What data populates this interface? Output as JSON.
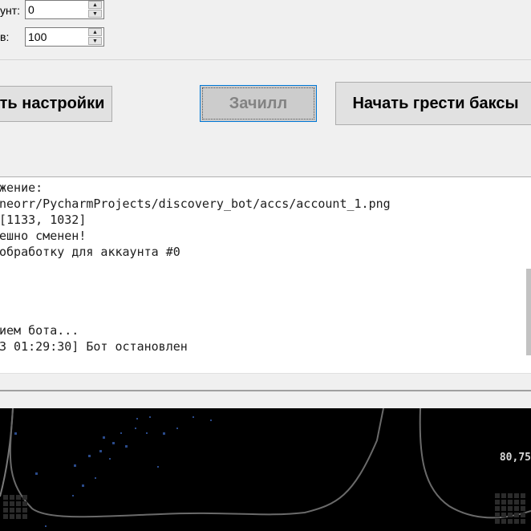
{
  "settings": {
    "account_label": "унт:",
    "account_value": "0",
    "count_label": "в:",
    "count_value": "100"
  },
  "buttons": {
    "save_settings": "ть настройки",
    "chill": "Зачилл",
    "start": "Начать грести баксы"
  },
  "log": {
    "lines": [
      "жение:",
      "neorr/PycharmProjects/discovery_bot/accs/account_1.png",
      "[1133, 1032]",
      "ешно сменен!",
      "обработку для аккаунта #0",
      "",
      "",
      "",
      "ием бота...",
      "3 01:29:30] Бот остановлен"
    ]
  },
  "game_view": {
    "fps_readout": "80,75"
  },
  "colors": {
    "window_bg": "#f0f0f0",
    "game_bg": "#000000",
    "focus_border": "#0078d7"
  }
}
